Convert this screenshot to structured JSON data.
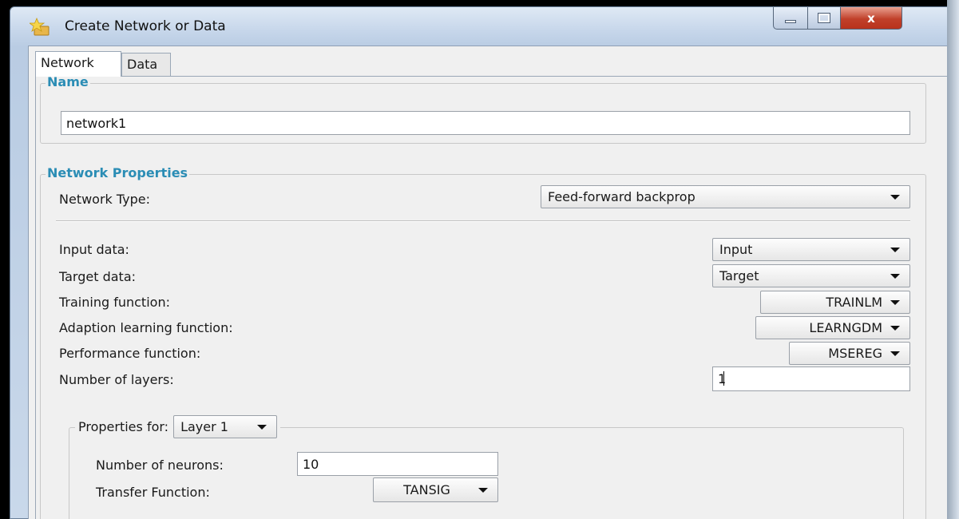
{
  "window": {
    "title": "Create Network or Data",
    "icon": "star-folder-icon",
    "close_label": "x"
  },
  "tabs": [
    {
      "label": "Network",
      "active": true
    },
    {
      "label": "Data",
      "active": false
    }
  ],
  "name_section": {
    "legend": "Name",
    "value": "network1"
  },
  "props_section": {
    "legend": "Network Properties",
    "network_type_label": "Network Type:",
    "network_type_value": "Feed-forward backprop",
    "input_data_label": "Input data:",
    "input_data_value": "Input",
    "target_data_label": "Target data:",
    "target_data_value": "Target",
    "training_fn_label": "Training function:",
    "training_fn_value": "TRAINLM",
    "adaption_fn_label": "Adaption learning function:",
    "adaption_fn_value": "LEARNGDM",
    "performance_fn_label": "Performance function:",
    "performance_fn_value": "MSEREG",
    "num_layers_label": "Number of layers:",
    "num_layers_value": "1"
  },
  "layer_section": {
    "properties_for_label": "Properties for:",
    "layer_value": "Layer 1",
    "num_neurons_label": "Number of neurons:",
    "num_neurons_value": "10",
    "transfer_fn_label": "Transfer Function:",
    "transfer_fn_value": "TANSIG"
  },
  "colors": {
    "legend_text": "#2b8db5",
    "close_button": "#c0402a"
  }
}
